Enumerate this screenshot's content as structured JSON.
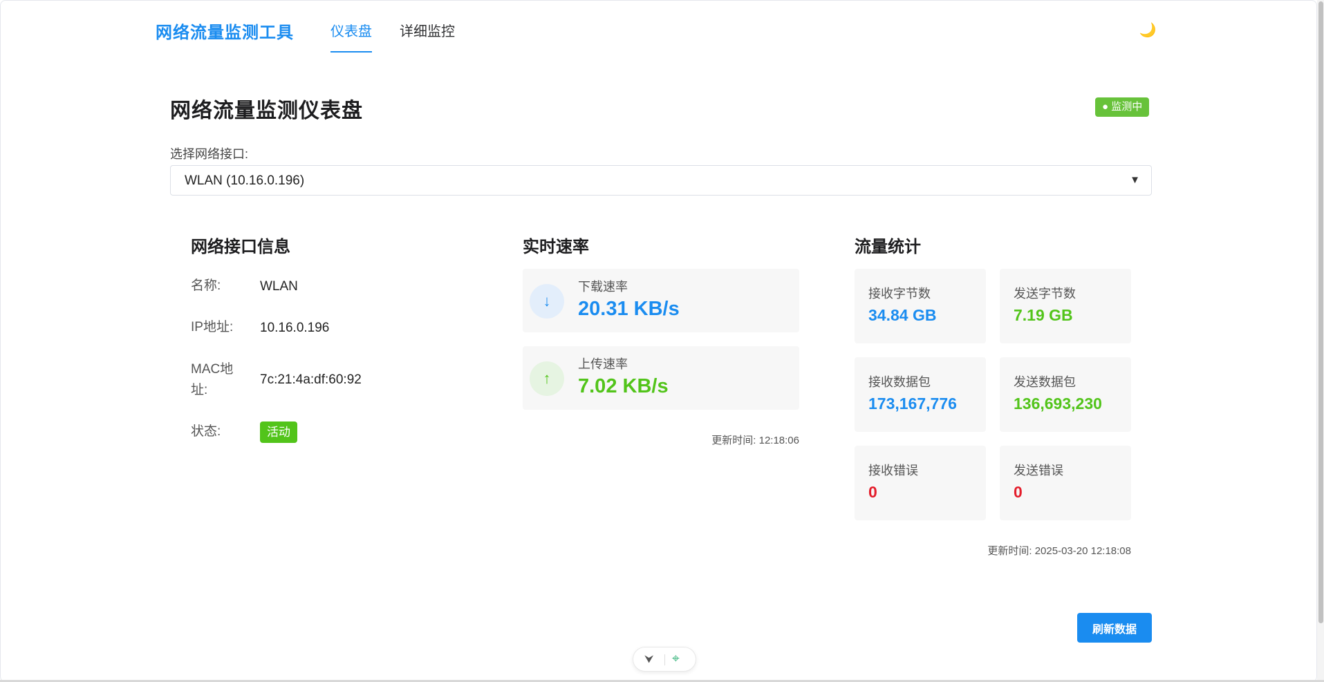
{
  "header": {
    "brand": "网络流量监测工具",
    "tabs": [
      {
        "label": "仪表盘",
        "active": true
      },
      {
        "label": "详细监控",
        "active": false
      }
    ],
    "theme_icon": "moon-icon",
    "theme_glyph": "🌙"
  },
  "page": {
    "title": "网络流量监测仪表盘",
    "status_badge": "● 监测中"
  },
  "interface_select": {
    "label": "选择网络接口:",
    "value": "WLAN (10.16.0.196)",
    "caret": "▼"
  },
  "interface_info": {
    "title": "网络接口信息",
    "rows": [
      {
        "key": "名称:",
        "value": "WLAN"
      },
      {
        "key": "IP地址:",
        "value": "10.16.0.196"
      },
      {
        "key_line1": "MAC地",
        "key_line2": "址:",
        "value": "7c:21:4a:df:60:92"
      },
      {
        "key": "状态:",
        "value": "活动"
      }
    ]
  },
  "speed": {
    "title": "实时速率",
    "download": {
      "label": "下载速率",
      "value": "20.31 KB/s",
      "icon": "arrow-down-icon",
      "glyph": "↓"
    },
    "upload": {
      "label": "上传速率",
      "value": "7.02 KB/s",
      "icon": "arrow-up-icon",
      "glyph": "↑"
    },
    "updated": "更新时间: 12:18:06"
  },
  "stats": {
    "title": "流量统计",
    "items": [
      {
        "label": "接收字节数",
        "value": "34.84 GB"
      },
      {
        "label": "发送字节数",
        "value": "7.19 GB"
      },
      {
        "label": "接收数据包",
        "value": "173,167,776"
      },
      {
        "label": "发送数据包",
        "value": "136,693,230"
      },
      {
        "label": "接收错误",
        "value": "0"
      },
      {
        "label": "发送错误",
        "value": "0"
      }
    ],
    "updated": "更新时间: 2025-03-20 12:18:08"
  },
  "actions": {
    "refresh_label": "刷新数据"
  },
  "devtools": {
    "vue_glyph": "⮟",
    "target_glyph": "⌖"
  },
  "colors": {
    "primary": "#1a8cf0",
    "success": "#52c41a",
    "badge_green": "#67c23a",
    "error": "#e41e2c"
  }
}
